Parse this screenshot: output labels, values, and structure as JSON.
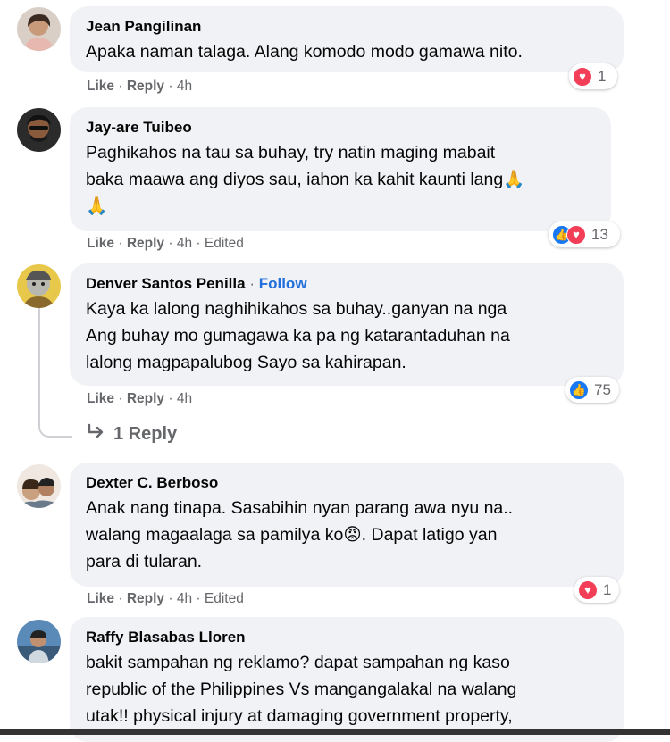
{
  "comments": [
    {
      "author": "Jean Pangilinan",
      "lines": [
        "Apaka naman talaga. Alang komodo modo gamawa nito."
      ],
      "actions": {
        "like": "Like",
        "reply": "Reply",
        "time": "4h",
        "edited": ""
      },
      "reactions": {
        "icons": [
          "love"
        ],
        "count": "1"
      }
    },
    {
      "author": "Jay-are Tuibeo",
      "lines": [
        "Paghikahos na tau sa buhay, try natin maging mabait",
        "baka maawa ang diyos sau, iahon ka kahit kaunti lang🙏",
        "🙏"
      ],
      "actions": {
        "like": "Like",
        "reply": "Reply",
        "time": "4h",
        "edited": "Edited"
      },
      "reactions": {
        "icons": [
          "like",
          "love"
        ],
        "count": "13"
      }
    },
    {
      "author": "Denver Santos Penilla",
      "follow": "Follow",
      "lines": [
        "Kaya ka lalong naghihikahos sa buhay..ganyan na nga",
        "Ang buhay mo gumagawa ka pa ng katarantaduhan na",
        "lalong magpapalubog Sayo sa kahirapan."
      ],
      "actions": {
        "like": "Like",
        "reply": "Reply",
        "time": "4h",
        "edited": ""
      },
      "reactions": {
        "icons": [
          "like"
        ],
        "count": "75"
      },
      "replies_label": "1 Reply"
    },
    {
      "author": "Dexter C. Berboso",
      "lines": [
        "Anak nang tinapa. Sasabihin nyan parang awa nyu na..",
        "walang magaalaga sa pamilya ko😡. Dapat latigo yan",
        "para di tularan."
      ],
      "actions": {
        "like": "Like",
        "reply": "Reply",
        "time": "4h",
        "edited": "Edited"
      },
      "reactions": {
        "icons": [
          "love"
        ],
        "count": "1"
      }
    },
    {
      "author": "Raffy Blasabas Lloren",
      "lines": [
        "bakit sampahan ng reklamo? dapat sampahan ng kaso",
        "republic of the Philippines Vs mangangalakal na walang",
        "utak!! physical injury at damaging government property,"
      ]
    }
  ],
  "separator": "·",
  "colors": {
    "bubble": "#f0f2f5",
    "link": "#216fdb",
    "meta": "#65676b",
    "love": "#f33e58",
    "like": "#1877f2"
  }
}
